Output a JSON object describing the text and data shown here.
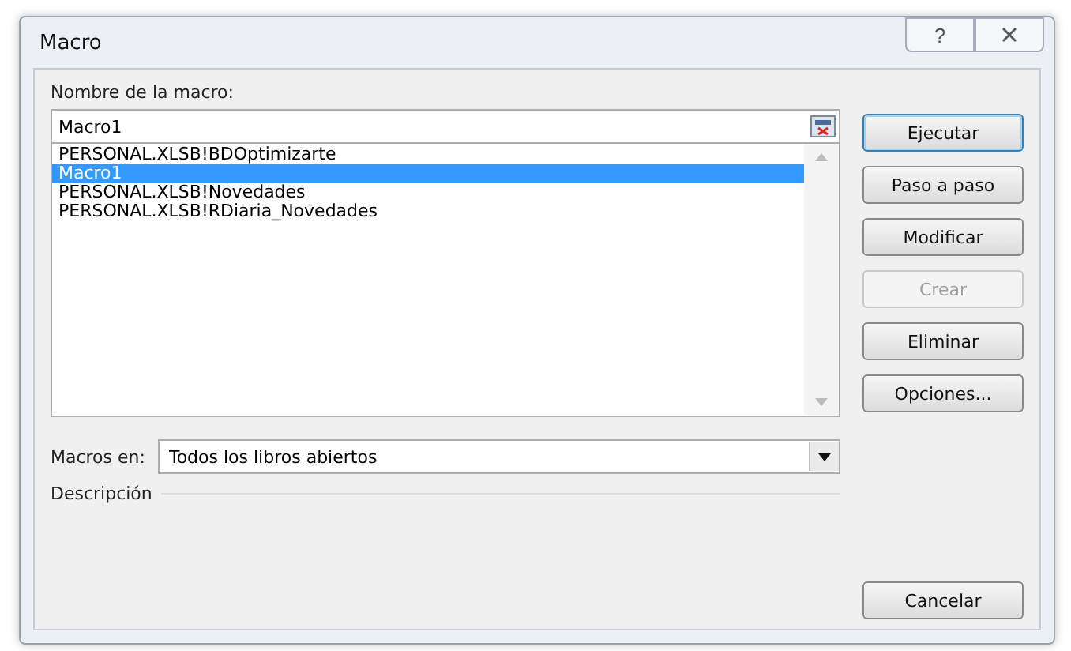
{
  "window": {
    "title": "Macro",
    "help_button": "?"
  },
  "name_label": "Nombre de la macro:",
  "name_value": "Macro1",
  "macros": [
    {
      "label": "PERSONAL.XLSB!BDOptimizarte",
      "selected": false
    },
    {
      "label": "Macro1",
      "selected": true
    },
    {
      "label": "PERSONAL.XLSB!Novedades",
      "selected": false
    },
    {
      "label": "PERSONAL.XLSB!RDiaria_Novedades",
      "selected": false
    }
  ],
  "macros_in": {
    "label": "Macros en:",
    "value": "Todos los libros abiertos"
  },
  "description_label": "Descripción",
  "buttons": [
    {
      "label": "Ejecutar",
      "default": true,
      "disabled": false
    },
    {
      "label": "Paso a paso",
      "default": false,
      "disabled": false
    },
    {
      "label": "Modificar",
      "default": false,
      "disabled": false
    },
    {
      "label": "Crear",
      "default": false,
      "disabled": true
    },
    {
      "label": "Eliminar",
      "default": false,
      "disabled": false
    },
    {
      "label": "Opciones...",
      "default": false,
      "disabled": false
    }
  ],
  "cancel_button": "Cancelar"
}
